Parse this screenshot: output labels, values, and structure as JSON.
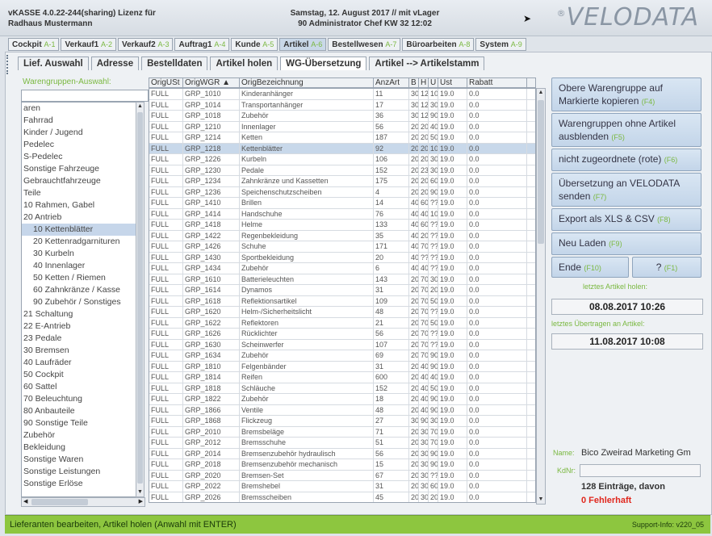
{
  "titlebar": {
    "line1": "vKASSE 4.0.22-244(sharing) Lizenz für",
    "line2": "Radhaus Mustermann",
    "date_line": "Samstag, 12. August 2017 // mit vLager",
    "user_line": "90 Administrator Chef   KW 32  12:02",
    "logo": "VELODATA",
    "logo_mark": "®"
  },
  "main_tabs": [
    {
      "label": "Cockpit",
      "key": "A-1"
    },
    {
      "label": "Verkauf1",
      "key": "A-2"
    },
    {
      "label": "Verkauf2",
      "key": "A-3"
    },
    {
      "label": "Auftrag1",
      "key": "A-4"
    },
    {
      "label": "Kunde",
      "key": "A-5"
    },
    {
      "label": "Artikel",
      "key": "A-6"
    },
    {
      "label": "Bestellwesen",
      "key": "A-7"
    },
    {
      "label": "Büroarbeiten",
      "key": "A-8"
    },
    {
      "label": "System",
      "key": "A-9"
    }
  ],
  "sub_tabs": [
    {
      "label": "Lief. Auswahl"
    },
    {
      "label": "Adresse"
    },
    {
      "label": "Bestelldaten"
    },
    {
      "label": "Artikel holen"
    },
    {
      "label": "WG-Übersetzung"
    },
    {
      "label": "Artikel --> Artikelstamm"
    }
  ],
  "wg_panel": {
    "label": "Warengruppen-Auswahl:",
    "search_value": "",
    "items": [
      "aren",
      "Fahrrad",
      "Kinder / Jugend",
      "Pedelec",
      "S-Pedelec",
      "Sonstige Fahrzeuge",
      "Gebrauchtfahrzeuge",
      "Teile",
      "10 Rahmen, Gabel",
      "20 Antrieb",
      "  10 Kettenblätter",
      "  20 Kettenradgarnituren",
      "  30 Kurbeln",
      "  40 Innenlager",
      "  50 Ketten / Riemen",
      "  60 Zahnkränze / Kasse",
      "  90 Zubehör / Sonstiges",
      "21 Schaltung",
      "22 E-Antrieb",
      "23 Pedale",
      "30 Bremsen",
      "40 Laufräder",
      "50 Cockpit",
      "60 Sattel",
      "70 Beleuchtung",
      "80 Anbauteile",
      "90 Sonstige Teile",
      "Zubehör",
      "Bekleidung",
      "Sonstige Waren",
      "Sonstige Leistungen",
      "Sonstige Erlöse"
    ]
  },
  "grid": {
    "columns": [
      "OrigUSt",
      "OrigWGR ▲",
      "OrigBezeichnung",
      "AnzArt",
      "B",
      "H",
      "U",
      "Ust",
      "Rabatt"
    ],
    "rows": [
      [
        "FULL",
        "GRP_1010",
        "Kinderanhänger",
        "11",
        "30",
        "12",
        "10",
        "19.0",
        "0.0"
      ],
      [
        "FULL",
        "GRP_1014",
        "Transportanhänger",
        "17",
        "30",
        "12",
        "30",
        "19.0",
        "0.0"
      ],
      [
        "FULL",
        "GRP_1018",
        "Zubehör",
        "36",
        "30",
        "12",
        "90",
        "19.0",
        "0.0"
      ],
      [
        "FULL",
        "GRP_1210",
        "Innenlager",
        "56",
        "20",
        "20",
        "40",
        "19.0",
        "0.0"
      ],
      [
        "FULL",
        "GRP_1214",
        "Ketten",
        "187",
        "20",
        "20",
        "50",
        "19.0",
        "0.0"
      ],
      [
        "FULL",
        "GRP_1218",
        "Kettenblätter",
        "92",
        "20",
        "20",
        "10",
        "19.0",
        "0.0"
      ],
      [
        "FULL",
        "GRP_1226",
        "Kurbeln",
        "106",
        "20",
        "20",
        "30",
        "19.0",
        "0.0"
      ],
      [
        "FULL",
        "GRP_1230",
        "Pedale",
        "152",
        "20",
        "23",
        "30",
        "19.0",
        "0.0"
      ],
      [
        "FULL",
        "GRP_1234",
        "Zahnkränze und Kassetten",
        "175",
        "20",
        "20",
        "60",
        "19.0",
        "0.0"
      ],
      [
        "FULL",
        "GRP_1236",
        "Speichenschutzscheiben",
        "4",
        "20",
        "20",
        "90",
        "19.0",
        "0.0"
      ],
      [
        "FULL",
        "GRP_1410",
        "Brillen",
        "14",
        "40",
        "60",
        "??",
        "19.0",
        "0.0"
      ],
      [
        "FULL",
        "GRP_1414",
        "Handschuhe",
        "76",
        "40",
        "40",
        "10",
        "19.0",
        "0.0"
      ],
      [
        "FULL",
        "GRP_1418",
        "Helme",
        "133",
        "40",
        "60",
        "??",
        "19.0",
        "0.0"
      ],
      [
        "FULL",
        "GRP_1422",
        "Regenbekleidung",
        "35",
        "40",
        "20",
        "??",
        "19.0",
        "0.0"
      ],
      [
        "FULL",
        "GRP_1426",
        "Schuhe",
        "171",
        "40",
        "70",
        "??",
        "19.0",
        "0.0"
      ],
      [
        "FULL",
        "GRP_1430",
        "Sportbekleidung",
        "20",
        "40",
        "??",
        "??",
        "19.0",
        "0.0"
      ],
      [
        "FULL",
        "GRP_1434",
        "Zubehör",
        "6",
        "40",
        "40",
        "??",
        "19.0",
        "0.0"
      ],
      [
        "FULL",
        "GRP_1610",
        "Batterieleuchten",
        "143",
        "20",
        "70",
        "30",
        "19.0",
        "0.0"
      ],
      [
        "FULL",
        "GRP_1614",
        "Dynamos",
        "31",
        "20",
        "70",
        "20",
        "19.0",
        "0.0"
      ],
      [
        "FULL",
        "GRP_1618",
        "Reflektionsartikel",
        "109",
        "20",
        "70",
        "50",
        "19.0",
        "0.0"
      ],
      [
        "FULL",
        "GRP_1620",
        "Helm-/Sicherheitslicht",
        "48",
        "20",
        "70",
        "??",
        "19.0",
        "0.0"
      ],
      [
        "FULL",
        "GRP_1622",
        "Reflektoren",
        "21",
        "20",
        "70",
        "50",
        "19.0",
        "0.0"
      ],
      [
        "FULL",
        "GRP_1626",
        "Rücklichter",
        "56",
        "20",
        "70",
        "??",
        "19.0",
        "0.0"
      ],
      [
        "FULL",
        "GRP_1630",
        "Scheinwerfer",
        "107",
        "20",
        "70",
        "??",
        "19.0",
        "0.0"
      ],
      [
        "FULL",
        "GRP_1634",
        "Zubehör",
        "69",
        "20",
        "70",
        "90",
        "19.0",
        "0.0"
      ],
      [
        "FULL",
        "GRP_1810",
        "Felgenbänder",
        "31",
        "20",
        "40",
        "90",
        "19.0",
        "0.0"
      ],
      [
        "FULL",
        "GRP_1814",
        "Reifen",
        "600",
        "20",
        "40",
        "40",
        "19.0",
        "0.0"
      ],
      [
        "FULL",
        "GRP_1818",
        "Schläuche",
        "152",
        "20",
        "40",
        "50",
        "19.0",
        "0.0"
      ],
      [
        "FULL",
        "GRP_1822",
        "Zubehör",
        "18",
        "20",
        "40",
        "90",
        "19.0",
        "0.0"
      ],
      [
        "FULL",
        "GRP_1866",
        "Ventile",
        "48",
        "20",
        "40",
        "90",
        "19.0",
        "0.0"
      ],
      [
        "FULL",
        "GRP_1868",
        "Flickzeug",
        "27",
        "30",
        "90",
        "30",
        "19.0",
        "0.0"
      ],
      [
        "FULL",
        "GRP_2010",
        "Bremsbeläge",
        "71",
        "20",
        "30",
        "70",
        "19.0",
        "0.0"
      ],
      [
        "FULL",
        "GRP_2012",
        "Bremsschuhe",
        "51",
        "20",
        "30",
        "70",
        "19.0",
        "0.0"
      ],
      [
        "FULL",
        "GRP_2014",
        "Bremsenzubehör hydraulisch",
        "56",
        "20",
        "30",
        "90",
        "19.0",
        "0.0"
      ],
      [
        "FULL",
        "GRP_2018",
        "Bremsenzubehör mechanisch",
        "15",
        "20",
        "30",
        "90",
        "19.0",
        "0.0"
      ],
      [
        "FULL",
        "GRP_2020",
        "Bremsen-Set",
        "67",
        "20",
        "30",
        "??",
        "19.0",
        "0.0"
      ],
      [
        "FULL",
        "GRP_2022",
        "Bremshebel",
        "31",
        "20",
        "30",
        "60",
        "19.0",
        "0.0"
      ],
      [
        "FULL",
        "GRP_2026",
        "Bremsscheiben",
        "45",
        "20",
        "30",
        "20",
        "19.0",
        "0.0"
      ]
    ]
  },
  "buttons": {
    "copy": {
      "label": "Obere Warengruppe auf Markierte kopieren",
      "key": "(F4)"
    },
    "hide": {
      "label": "Warengruppen ohne Artikel ausblenden",
      "key": "(F5)"
    },
    "unassigned": {
      "label": "nicht zugeordnete (rote)",
      "key": "(F6)"
    },
    "send": {
      "label": "Übersetzung an VELODATA senden",
      "key": "(F7)"
    },
    "export": {
      "label": "Export als XLS & CSV",
      "key": "(F8)"
    },
    "reload": {
      "label": "Neu Laden",
      "key": "(F9)"
    },
    "end": {
      "label": "Ende",
      "key": "(F10)"
    },
    "help": {
      "label": "?",
      "key": "(F1)"
    }
  },
  "info": {
    "last_fetch_label": "letztes Artikel holen:",
    "last_fetch_value": "08.08.2017 10:26",
    "last_transfer_label": "letztes Übertragen an Artikel:",
    "last_transfer_value": "11.08.2017 10:08",
    "name_label": "Name:",
    "name_value": "Bico Zweirad Marketing Gm",
    "kdnr_label": "KdNr:",
    "entries": "128 Einträge, davon",
    "errors": "0 Fehlerhaft"
  },
  "status": {
    "text": "Lieferanten bearbeiten, Artikel holen (Anwahl mit ENTER)",
    "support": "Support-Info: v220_05"
  },
  "colors": {
    "accent_green": "#8dc63f",
    "error_red": "#e0281e",
    "selection": "#c8d8ea"
  }
}
